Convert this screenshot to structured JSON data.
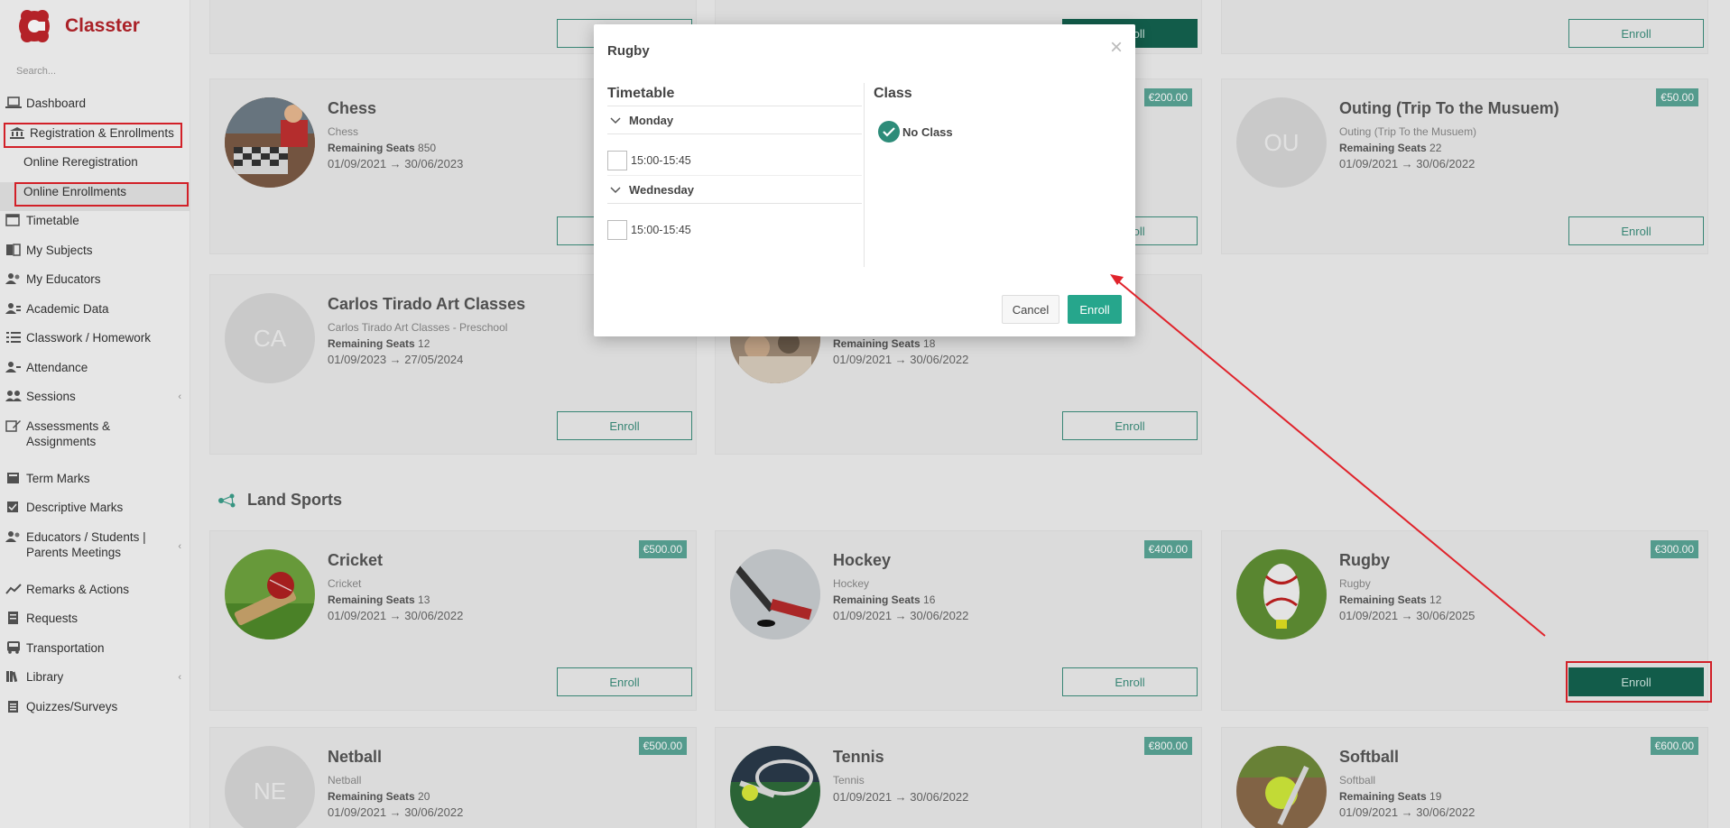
{
  "app": {
    "name": "Classter"
  },
  "search": {
    "placeholder": "Search..."
  },
  "sidebar": {
    "items": [
      {
        "label": "Dashboard"
      },
      {
        "label": "Registration & Enrollments"
      },
      {
        "label": "Online Reregistration"
      },
      {
        "label": "Online Enrollments"
      },
      {
        "label": "Timetable"
      },
      {
        "label": "My Subjects"
      },
      {
        "label": "My Educators"
      },
      {
        "label": "Academic Data"
      },
      {
        "label": "Classwork / Homework"
      },
      {
        "label": "Attendance"
      },
      {
        "label": "Sessions"
      },
      {
        "label": "Assessments & Assignments"
      },
      {
        "label": "Term Marks"
      },
      {
        "label": "Descriptive Marks"
      },
      {
        "label": "Educators / Students | Parents Meetings"
      },
      {
        "label": "Remarks & Actions"
      },
      {
        "label": "Requests"
      },
      {
        "label": "Transportation"
      },
      {
        "label": "Library"
      },
      {
        "label": "Quizzes/Surveys"
      }
    ]
  },
  "common": {
    "enroll": "Enroll",
    "remaining_seats": "Remaining Seats"
  },
  "cards": {
    "chess": {
      "title": "Chess",
      "sub": "Chess",
      "seats": "850",
      "dates": "01/09/2021 → 30/06/2023"
    },
    "mid1": {
      "price": "€200.00"
    },
    "outing": {
      "title": "Outing (Trip To the Musuem)",
      "sub": "Outing (Trip To the Musuem)",
      "seats": "22",
      "dates": "01/09/2021 → 30/06/2022",
      "price": "€50.00",
      "initials": "OU"
    },
    "carlos": {
      "title": "Carlos Tirado Art Classes",
      "sub": "Carlos Tirado Art Classes - Preschool",
      "seats": "12",
      "dates": "01/09/2023 → 27/05/2024",
      "initials": "CA"
    },
    "mid2": {
      "seats": "18",
      "dates": "01/09/2021 → 30/06/2022"
    },
    "cricket": {
      "title": "Cricket",
      "sub": "Cricket",
      "seats": "13",
      "dates": "01/09/2021 → 30/06/2022",
      "price": "€500.00"
    },
    "hockey": {
      "title": "Hockey",
      "sub": "Hockey",
      "seats": "16",
      "dates": "01/09/2021 → 30/06/2022",
      "price": "€400.00"
    },
    "rugby": {
      "title": "Rugby",
      "sub": "Rugby",
      "seats": "12",
      "dates": "01/09/2021 → 30/06/2025",
      "price": "€300.00"
    },
    "netball": {
      "title": "Netball",
      "sub": "Netball",
      "seats": "20",
      "dates": "01/09/2021 → 30/06/2022",
      "price": "€500.00",
      "initials": "NE"
    },
    "tennis": {
      "title": "Tennis",
      "sub": "Tennis",
      "dates": "01/09/2021 → 30/06/2022",
      "price": "€800.00"
    },
    "softball": {
      "title": "Softball",
      "sub": "Softball",
      "seats": "19",
      "dates": "01/09/2021 → 30/06/2022",
      "price": "€600.00"
    }
  },
  "section": {
    "land_sports": "Land Sports"
  },
  "modal": {
    "title": "Rugby",
    "close": "×",
    "timetable_heading": "Timetable",
    "class_heading": "Class",
    "days": [
      {
        "name": "Monday",
        "slot": "15:00-15:45"
      },
      {
        "name": "Wednesday",
        "slot": "15:00-15:45"
      }
    ],
    "class_option": "No Class",
    "cancel": "Cancel",
    "enroll": "Enroll"
  },
  "colors": {
    "brand": "#b5242a",
    "accent": "#26a68c",
    "highlight": "#e0232b"
  }
}
